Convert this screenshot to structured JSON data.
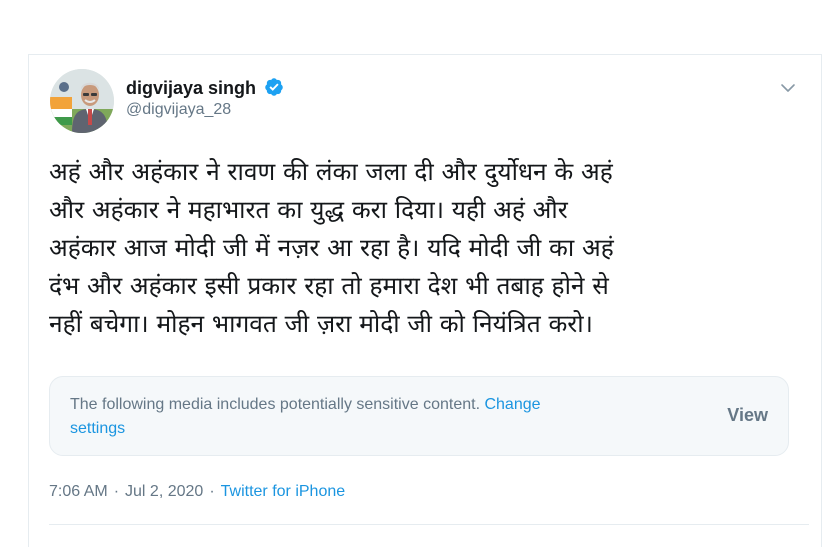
{
  "tweet": {
    "display_name": "digvijaya singh",
    "handle": "@digvijaya_28",
    "verified": true,
    "text_lines": [
      "अहं और अहंकार ने रावण की लंका जला दी और दुर्योधन के अहं",
      "और अहंकार ने महाभारत का युद्ध करा दिया। यही अहं और",
      "अहंकार आज मोदी जी में नज़र आ रहा है। यदि मोदी जी का अहं",
      "दंभ और अहंकार इसी प्रकार रहा तो हमारा देश भी तबाह होने से",
      "नहीं बचेगा। मोहन भागवत जी ज़रा मोदी जी को नियंत्रित करो।"
    ],
    "sensitive_notice": {
      "message": "The following media includes potentially sensitive content.",
      "link_text_1": "Change",
      "link_text_2": "settings",
      "view_label": "View"
    },
    "time": "7:06 AM",
    "date": "Jul 2, 2020",
    "separator": "·",
    "source": "Twitter for iPhone"
  },
  "icons": {
    "verified": "verified-badge-icon",
    "caret": "chevron-down-icon"
  },
  "colors": {
    "accent": "#1b95e0",
    "verified": "#1da1f2",
    "secondary_text": "#657786",
    "primary_text": "#14171a",
    "border": "#e6ecf0",
    "notice_bg": "#f5f8fa"
  }
}
